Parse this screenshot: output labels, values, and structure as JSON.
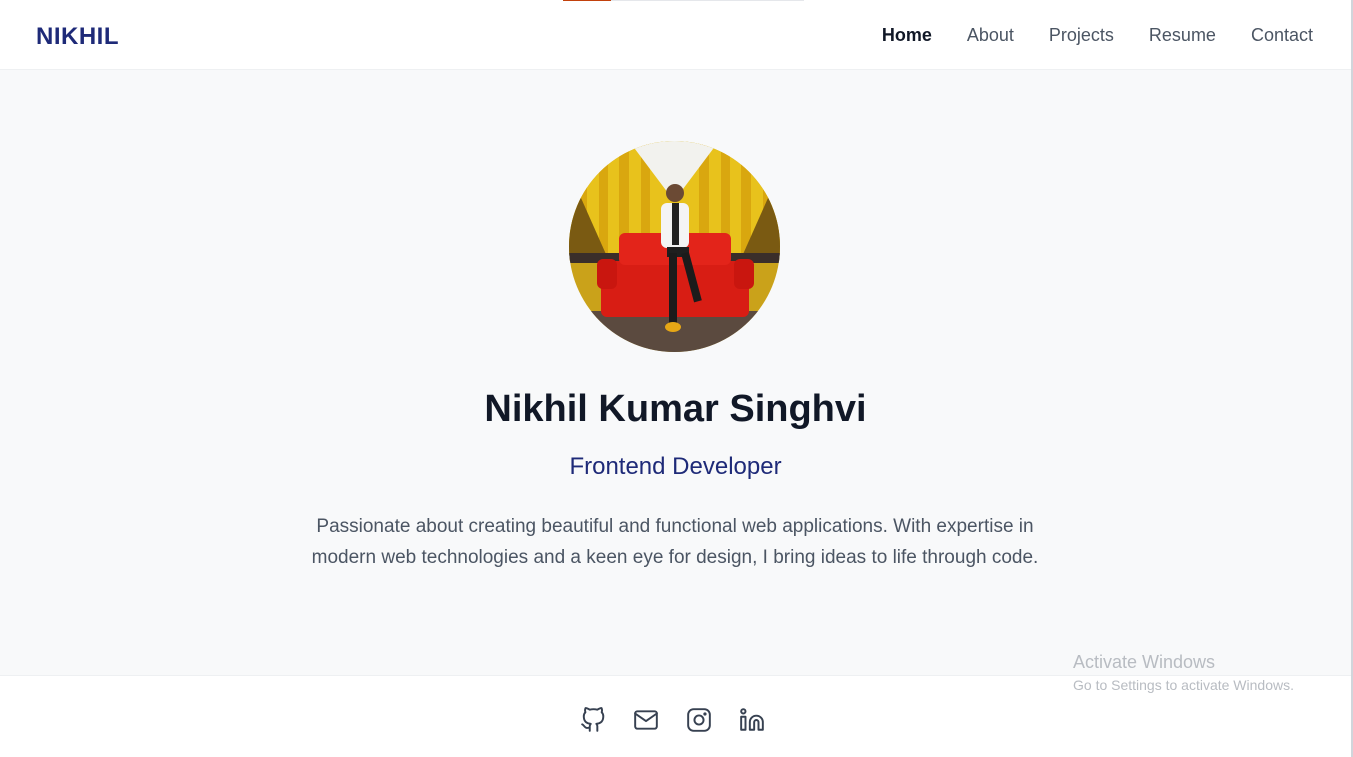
{
  "header": {
    "brand": "NIKHIL",
    "page_progress_fraction": 0.2,
    "nav": [
      "Home",
      "About",
      "Projects",
      "Resume",
      "Contact"
    ]
  },
  "hero": {
    "name": "Nikhil Kumar Singhvi",
    "role": "Frontend Developer",
    "bio": "Passionate about creating beautiful and functional web applications. With expertise in modern web technologies and a keen eye for design, I bring ideas to life through code."
  },
  "footer": {
    "icons": [
      "github-icon",
      "mail-icon",
      "instagram-icon",
      "linkedin-icon"
    ]
  },
  "watermark": {
    "title": "Activate Windows",
    "subtitle": "Go to Settings to activate Windows."
  },
  "colors": {
    "brand": "#1e2a78",
    "accent": "#c2410c"
  }
}
